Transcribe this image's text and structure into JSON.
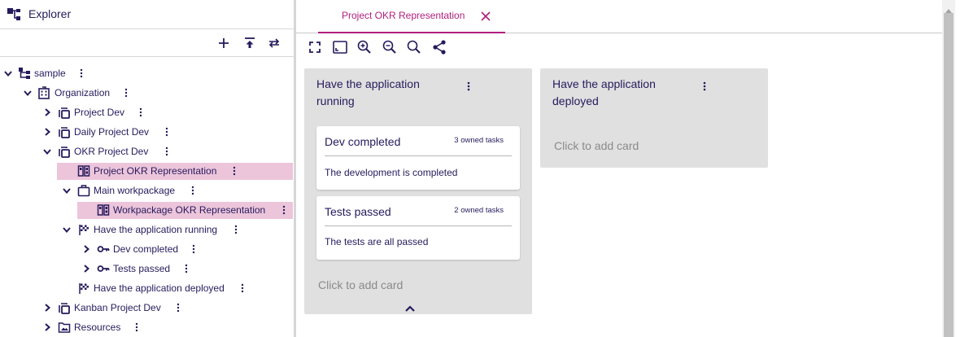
{
  "explorer": {
    "title": "Explorer",
    "icon": "tree-structure-icon",
    "toolbar": [
      {
        "name": "add-button",
        "icon": "plus-icon"
      },
      {
        "name": "collapse-to-top-button",
        "icon": "arrow-to-top-icon"
      },
      {
        "name": "sync-button",
        "icon": "swap-arrows-icon"
      }
    ]
  },
  "tree": [
    {
      "label": "sample",
      "icon": "tree-icon",
      "expanded": true,
      "selected": false
    },
    {
      "label": "Organization",
      "icon": "building-icon",
      "expanded": true,
      "selected": false
    },
    {
      "label": "Project Dev",
      "icon": "copy-icon",
      "expanded": false,
      "selected": false
    },
    {
      "label": "Daily Project Dev",
      "icon": "copy-icon",
      "expanded": false,
      "selected": false
    },
    {
      "label": "OKR Project Dev",
      "icon": "copy-icon",
      "expanded": true,
      "selected": false
    },
    {
      "label": "Project OKR Representation",
      "icon": "kanban-icon",
      "expanded": null,
      "selected": true
    },
    {
      "label": "Main workpackage",
      "icon": "briefcase-icon",
      "expanded": true,
      "selected": false
    },
    {
      "label": "Workpackage OKR Representation",
      "icon": "kanban-icon",
      "expanded": null,
      "selected": true
    },
    {
      "label": "Have the application running",
      "icon": "checkered-flag-icon",
      "expanded": true,
      "selected": false
    },
    {
      "label": "Dev completed",
      "icon": "key-icon",
      "expanded": false,
      "selected": false
    },
    {
      "label": "Tests passed",
      "icon": "key-icon",
      "expanded": false,
      "selected": false
    },
    {
      "label": "Have the application deployed",
      "icon": "checkered-flag-icon",
      "expanded": null,
      "selected": false
    },
    {
      "label": "Kanban Project Dev",
      "icon": "copy-icon",
      "expanded": false,
      "selected": false
    },
    {
      "label": "Resources",
      "icon": "folder-image-icon",
      "expanded": false,
      "selected": false
    }
  ],
  "editor": {
    "tab": {
      "label": "Project OKR Representation",
      "close_icon": "close-icon"
    },
    "toolbar": [
      {
        "name": "fit-screen-button",
        "icon": "fullscreen-corners-icon"
      },
      {
        "name": "fit-selection-button",
        "icon": "aspect-ratio-icon"
      },
      {
        "name": "zoom-in-button",
        "icon": "zoom-in-icon"
      },
      {
        "name": "zoom-out-button",
        "icon": "zoom-out-icon"
      },
      {
        "name": "zoom-reset-button",
        "icon": "magnifier-icon"
      },
      {
        "name": "share-button",
        "icon": "share-icon"
      }
    ],
    "columns": [
      {
        "title": "Have the application running",
        "cards": [
          {
            "title": "Dev completed",
            "count": "3 owned tasks",
            "description": "The development is completed"
          },
          {
            "title": "Tests passed",
            "count": "2 owned tasks",
            "description": "The tests are all passed"
          }
        ],
        "add_card": "Click to add card",
        "collapse_icon": "chevron-up-icon"
      },
      {
        "title": "Have the application deployed",
        "cards": [],
        "add_card": "Click to add card"
      }
    ]
  },
  "colors": {
    "text": "#261a5c",
    "accent": "#b01f7c",
    "selection": "#ecc5db",
    "column_bg": "#e0e0e0",
    "muted": "#8a8a8a"
  }
}
